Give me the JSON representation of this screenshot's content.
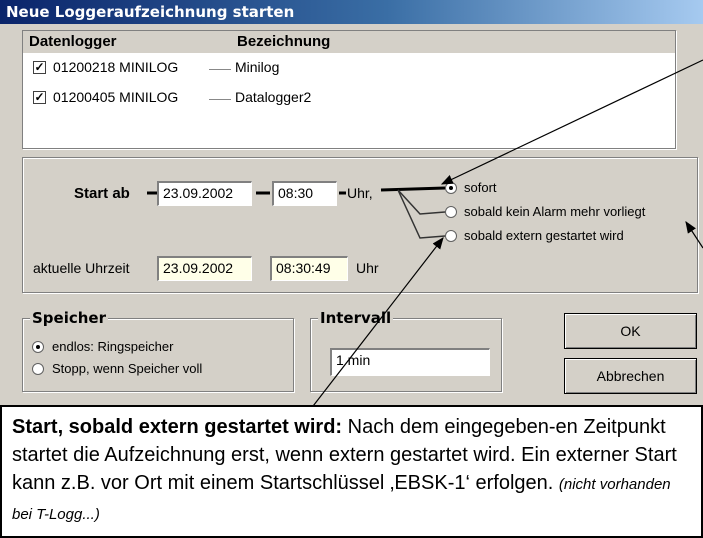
{
  "dialog": {
    "title": "Neue Loggeraufzeichnung starten"
  },
  "loggers": {
    "col_device": "Datenlogger",
    "col_name": "Bezeichnung",
    "rows": [
      {
        "checked": true,
        "device": "01200218 MINILOG",
        "name": "Minilog"
      },
      {
        "checked": true,
        "device": "01200405 MINILOG",
        "name": "Datalogger2"
      }
    ]
  },
  "start": {
    "label": "Start ab",
    "date": "23.09.2002",
    "time": "08:30",
    "unit": "Uhr,",
    "options": [
      "sofort",
      "sobald kein Alarm mehr vorliegt",
      "sobald extern gestartet wird"
    ],
    "selected": 0,
    "now_label": "aktuelle Uhrzeit",
    "now_date": "23.09.2002",
    "now_time": "08:30:49",
    "now_unit": "Uhr"
  },
  "storage": {
    "title": "Speicher",
    "options": [
      "endlos: Ringspeicher",
      "Stopp, wenn Speicher voll"
    ],
    "selected": 0
  },
  "interval": {
    "title": "Intervall",
    "value": "1 min"
  },
  "buttons": {
    "ok": "OK",
    "cancel": "Abbrechen"
  },
  "info": {
    "bold": "Start, sobald extern gestartet wird:",
    "text": " Nach dem eingegeben-en Zeitpunkt startet die Aufzeichnung erst, wenn extern gestartet wird. Ein externer Start kann z.B. vor Ort mit einem Startschlüssel ‚EBSK-1‘ erfolgen.",
    "note": "(nicht vorhanden bei T-Logg...)"
  }
}
